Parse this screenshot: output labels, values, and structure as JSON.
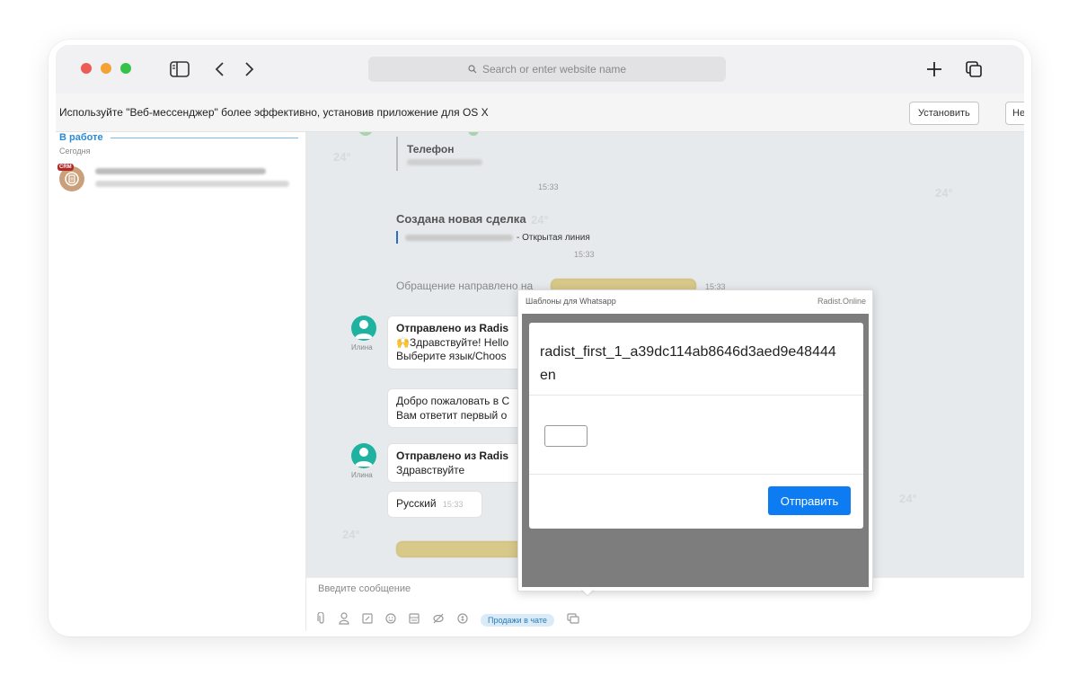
{
  "browser": {
    "address_placeholder": "Search or enter website name",
    "traffic_light_colors": [
      "#ec5b56",
      "#f4a234",
      "#36c247"
    ]
  },
  "banner": {
    "text": "Используйте \"Веб-мессенджер\" более эффективно, установив приложение для OS X",
    "install_label": "Установить",
    "no_label": "Нет, с"
  },
  "sidebar": {
    "section_title": "В работе",
    "date_group": "Сегодня",
    "chat_badge": "CRM"
  },
  "chat": {
    "phone_title": "Телефон",
    "time_1": "15:33",
    "deal_title": "Создана новая сделка",
    "deal_suffix": "- Открытая линия",
    "time_2": "15:33",
    "redirect_text": "Обращение направлено на",
    "time_3": "15:33",
    "msg1": {
      "author": "Илина",
      "title": "Отправлено из Radis",
      "line1": "🙌Здравствуйте! Hello",
      "line2": "Выберите язык/Choos"
    },
    "msg2": {
      "line1": "Добро пожаловать в С",
      "line2": "Вам ответит первый о"
    },
    "msg3": {
      "author": "Илина",
      "title": "Отправлено из Radis",
      "line1": "Здравствуйте"
    },
    "msg4": {
      "text": "Русский",
      "time": "15:33"
    }
  },
  "input": {
    "placeholder": "Введите сообщение",
    "sales_label": "Продажи в чате"
  },
  "popup": {
    "title": "Шаблоны для Whatsapp",
    "brand": "Radist.Online",
    "template_name": "radist_first_1_a39dc114ab8646d3aed9e48444",
    "template_lang": "en",
    "send_label": "Отправить"
  },
  "colors": {
    "accent": "#2a8bd6",
    "send_button": "#0d7cf2",
    "avatar": "#20b2a0",
    "chat_bg": "#e6eaed"
  }
}
